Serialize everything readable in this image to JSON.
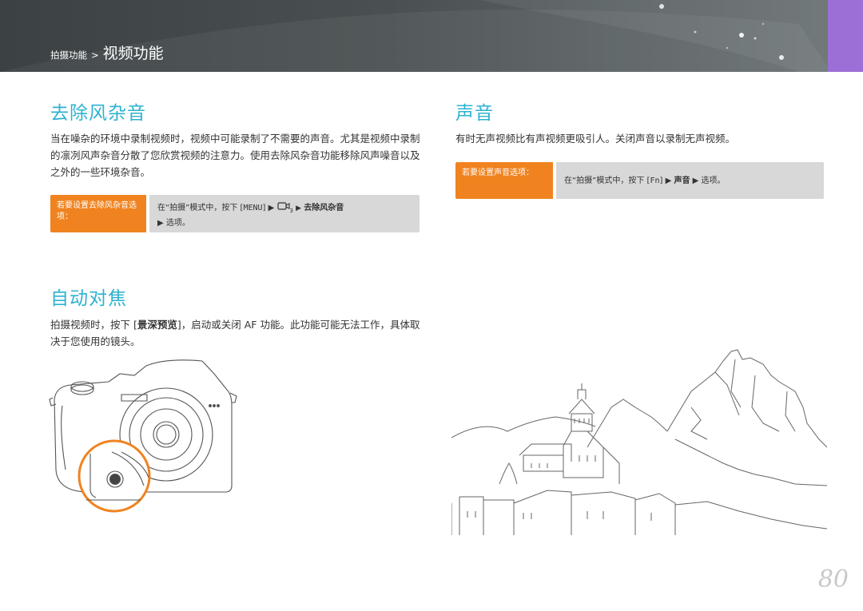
{
  "header": {
    "breadcrumb_parent": "拍摄功能",
    "breadcrumb_separator": ">",
    "breadcrumb_current": "视频功能"
  },
  "wind_cut": {
    "title": "去除风杂音",
    "body": "当在噪杂的环境中录制视频时，视频中可能录制了不需要的声音。尤其是视频中录制的凛冽风声杂音分散了您欣赏视频的注意力。使用去除风杂音功能移除风声噪音以及之外的一些环境杂音。",
    "tip_label": "若要设置去除风杂音选项：",
    "tip_prefix": "在“拍摄”模式中，按下 [",
    "tip_menu_key": "MENU",
    "tip_mid": "] ▶",
    "tip_icon_sub": "3",
    "tip_arrow": "▶",
    "tip_target": "去除风杂音",
    "tip_suffix": "▶ 选项。"
  },
  "sound": {
    "title": "声音",
    "body": "有时无声视频比有声视频更吸引人。关闭声音以录制无声视频。",
    "tip_label": "若要设置声音选项：",
    "tip_prefix": "在“拍摄”模式中，按下 [",
    "tip_key": "Fn",
    "tip_mid": "] ▶",
    "tip_target": "声音",
    "tip_suffix": "▶ 选项。"
  },
  "autofocus": {
    "title": "自动对焦",
    "body_prefix": "拍摄视频时，按下 [",
    "body_key": "景深预览",
    "body_suffix": "]，启动或关闭 AF 功能。此功能可能无法工作，具体取决于您使用的镜头。"
  },
  "page_number": "80",
  "colors": {
    "accent_title": "#2eb2cf",
    "tip_label_bg": "#f0831f",
    "tip_bg": "#d8d8d8",
    "header_tab": "#9b6fd6"
  }
}
